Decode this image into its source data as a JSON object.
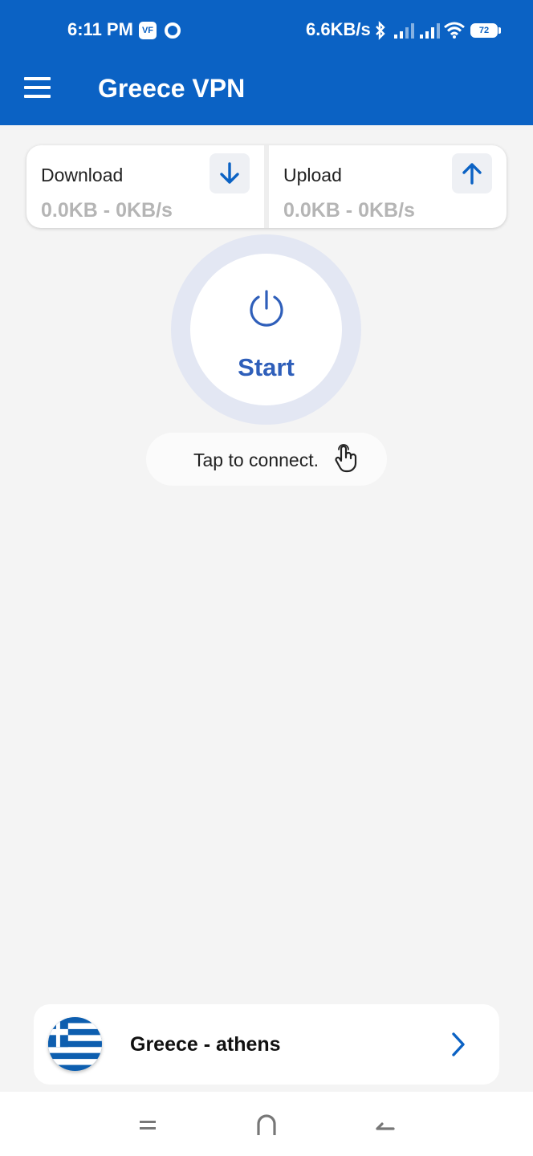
{
  "status_bar": {
    "time": "6:11 PM",
    "vpn_badge": "VF",
    "net_speed": "6.6KB/s",
    "battery": "72"
  },
  "app_bar": {
    "title": "Greece VPN",
    "menu_icon": "hamburger-menu-icon"
  },
  "stats": {
    "download": {
      "label": "Download",
      "value": "0.0KB - 0KB/s",
      "icon": "arrow-down-icon"
    },
    "upload": {
      "label": "Upload",
      "value": "0.0KB - 0KB/s",
      "icon": "arrow-up-icon"
    }
  },
  "connect": {
    "button_label": "Start",
    "icon": "power-icon",
    "hint": "Tap to connect.",
    "hint_icon": "tap-hand-icon"
  },
  "server": {
    "name": "Greece - athens",
    "flag": "greece-flag",
    "chevron": "chevron-right-icon"
  },
  "nav": {
    "items": [
      "recents-icon",
      "home-icon",
      "back-icon"
    ]
  },
  "colors": {
    "primary": "#0b62c4",
    "accent_blue": "#2f5fba",
    "muted_value": "#b5b5b5",
    "background": "#f4f4f4"
  }
}
